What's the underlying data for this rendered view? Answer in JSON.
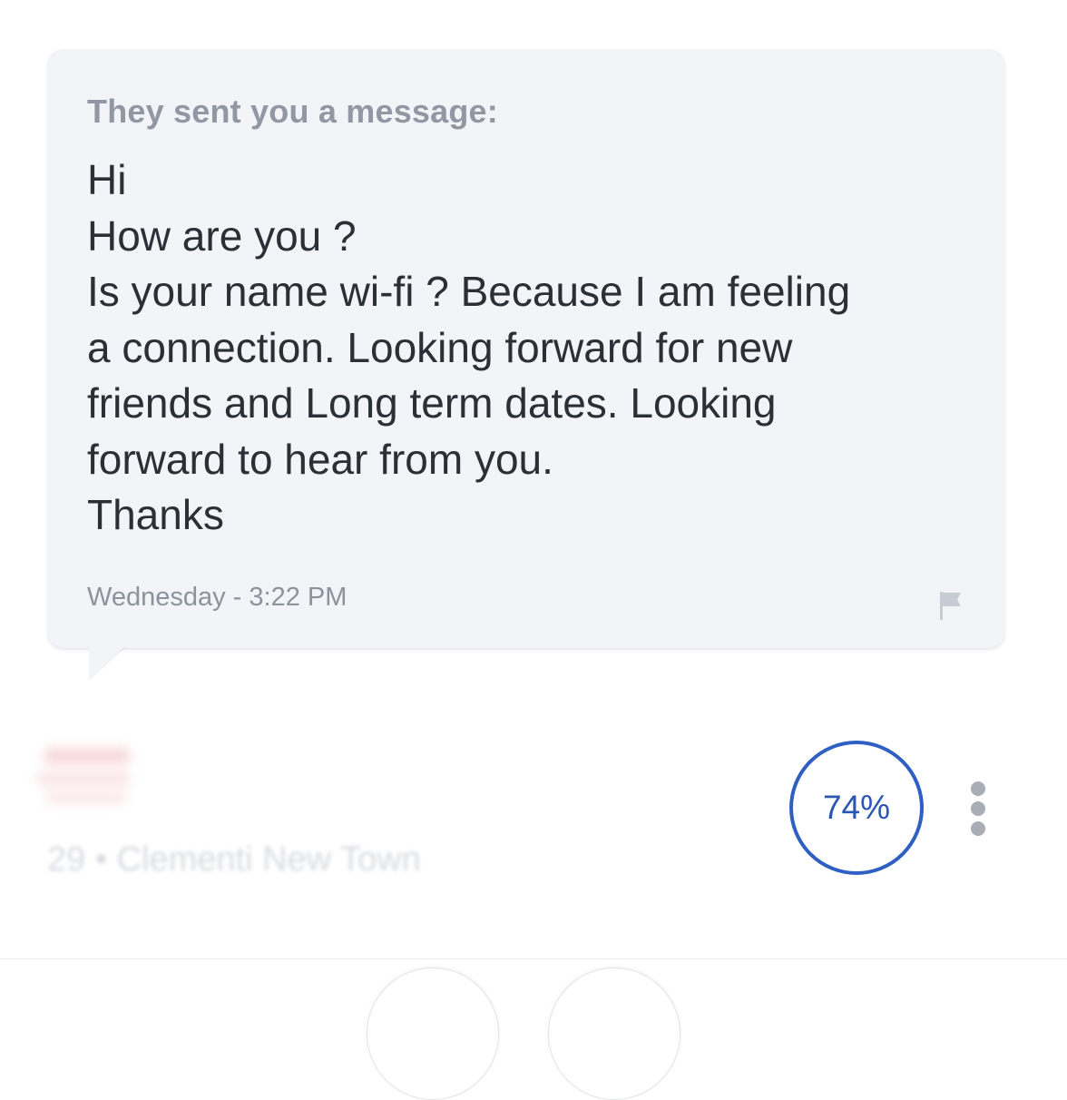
{
  "message_card": {
    "intro": "They sent you a message:",
    "lines": [
      "Hi",
      "How are you ?",
      "Is your name wi-fi ? Because I am feeling",
      "a connection. Looking forward for new",
      "friends and Long term dates. Looking",
      "forward to hear from you.",
      "Thanks"
    ],
    "timestamp": "Wednesday - 3:22 PM",
    "report_icon": "flag-icon"
  },
  "profile": {
    "location": "29 • Clementi New Town",
    "match_percent": "74%",
    "more_icon": "more-vertical-icon"
  },
  "colors": {
    "bubble_bg": "#f3f4f8",
    "match_ring": "#2f5fc2",
    "muted_text": "#9298a3",
    "body_text": "#2b2f36"
  }
}
